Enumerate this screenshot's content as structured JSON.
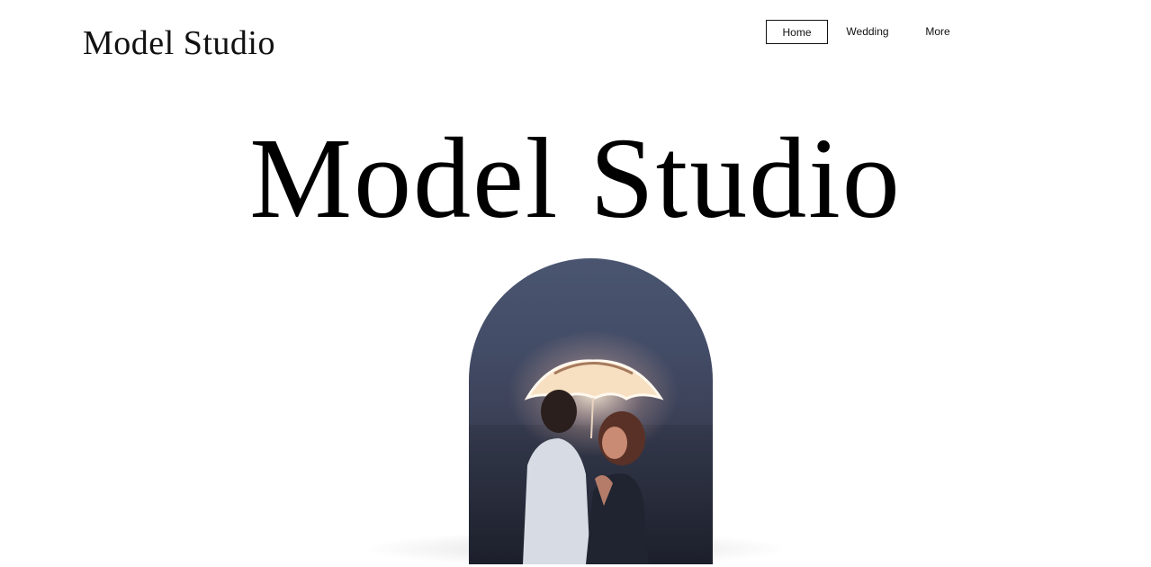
{
  "header": {
    "brand": "Model Studio",
    "nav": [
      {
        "label": "Home",
        "active": true
      },
      {
        "label": "Wedding",
        "active": false
      },
      {
        "label": "More",
        "active": false
      }
    ]
  },
  "hero": {
    "title": "Model Studio"
  },
  "colors": {
    "background": "#ffffff",
    "text": "#000000",
    "photo_sky": "#4a5570",
    "umbrella_glow": "#fff6e8"
  }
}
